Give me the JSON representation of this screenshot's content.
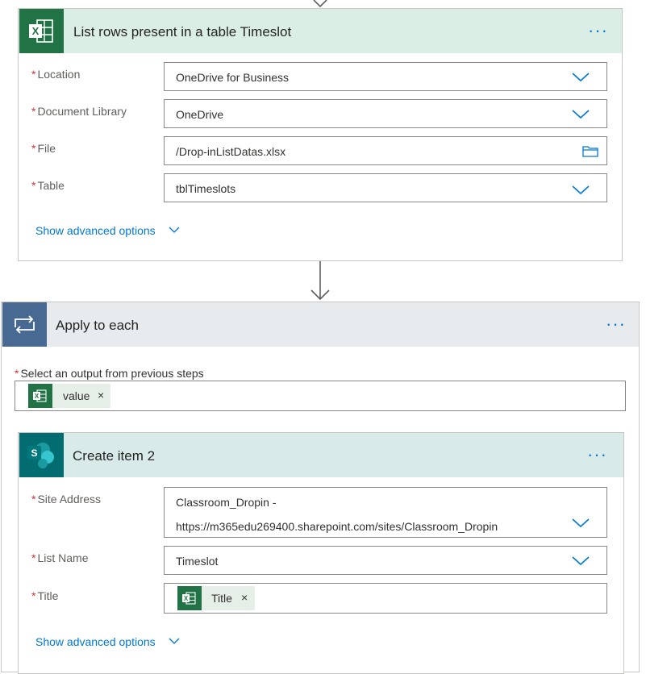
{
  "connectors": {
    "top_arrow": "down-arrow",
    "middle_arrow": "down-arrow"
  },
  "excel_step": {
    "title": "List rows present in a table Timeslot",
    "icon": "excel-icon",
    "accent_color": "#dbeee5",
    "more_label": "···",
    "fields": {
      "location": {
        "required_mark": "*",
        "label": "Location",
        "value": "OneDrive for Business"
      },
      "library": {
        "required_mark": "*",
        "label": "Document Library",
        "value": "OneDrive"
      },
      "file": {
        "required_mark": "*",
        "label": "File",
        "value": "/Drop-inListDatas.xlsx"
      },
      "table": {
        "required_mark": "*",
        "label": "Table",
        "value": "tblTimeslots"
      }
    },
    "advanced_label": "Show advanced options"
  },
  "apply_step": {
    "title": "Apply to each",
    "icon": "loop-icon",
    "accent_color": "#e8ebee",
    "more_label": "···",
    "select_output": {
      "required_mark": "*",
      "label": "Select an output from previous steps",
      "token": {
        "icon": "excel-icon",
        "text": "value",
        "remove": "×"
      }
    }
  },
  "create_step": {
    "title": "Create item 2",
    "icon": "sharepoint-icon",
    "accent_color": "#d9ebe9",
    "more_label": "···",
    "fields": {
      "site": {
        "required_mark": "*",
        "label": "Site Address",
        "value_line1": "Classroom_Dropin -",
        "value_line2": "https://m365edu269400.sharepoint.com/sites/Classroom_Dropin"
      },
      "list": {
        "required_mark": "*",
        "label": "List Name",
        "value": "Timeslot"
      },
      "title": {
        "required_mark": "*",
        "label": "Title",
        "token": {
          "icon": "excel-icon",
          "text": "Title",
          "remove": "×"
        }
      }
    },
    "advanced_label": "Show advanced options"
  }
}
